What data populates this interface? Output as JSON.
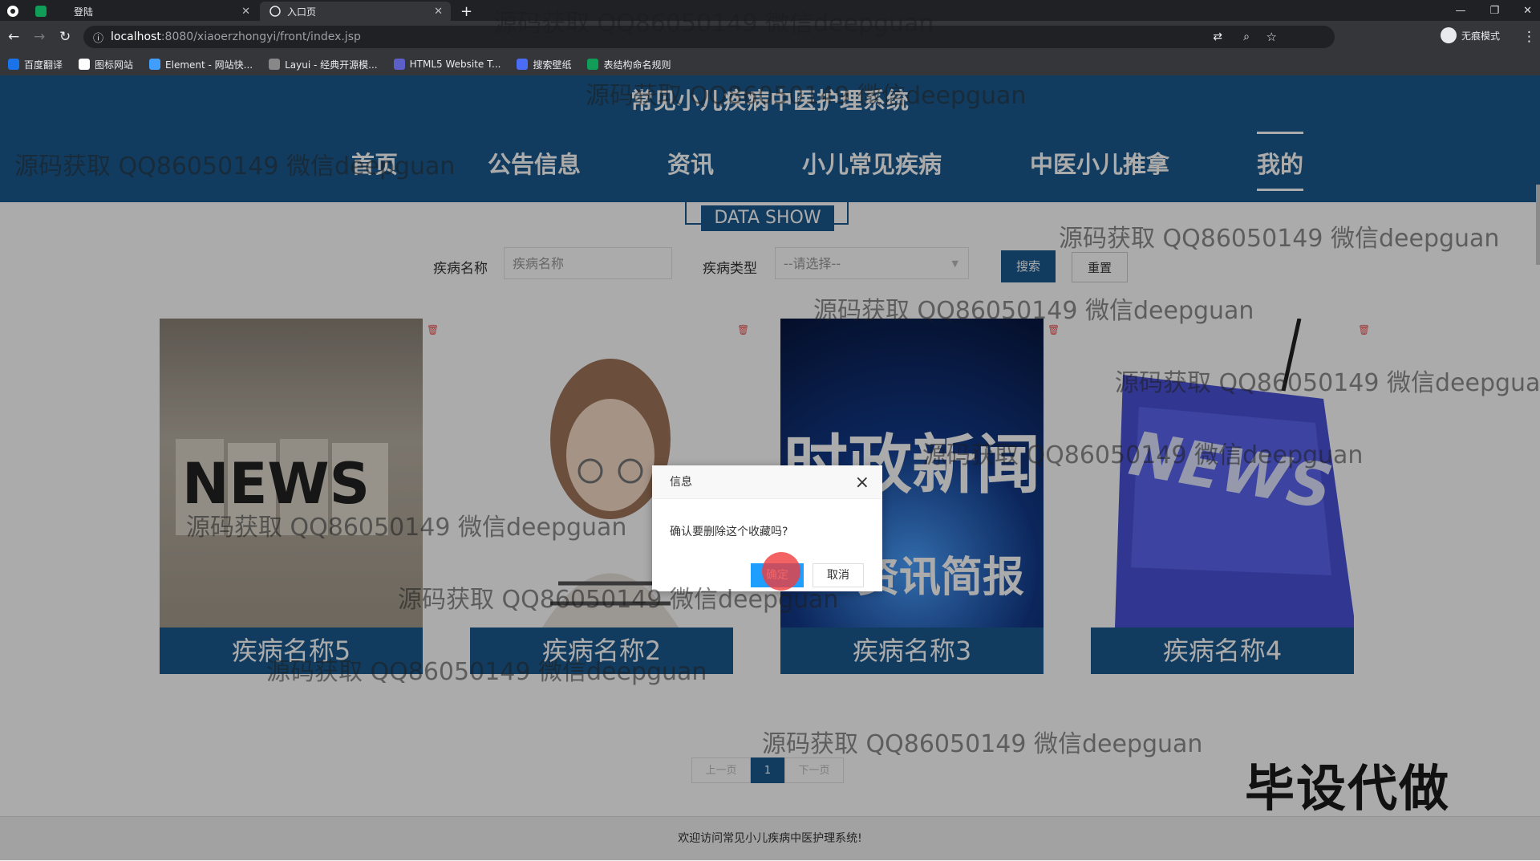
{
  "browser": {
    "tabs": [
      {
        "label": "登陆"
      },
      {
        "label": "入口页"
      }
    ],
    "new_tab": "+",
    "url_host": "localhost",
    "url_path": ":8080/xiaoerzhongyi/front/index.jsp",
    "profile": "无痕模式",
    "bookmarks": [
      {
        "label": "百度翻译",
        "color": "#1a73e8"
      },
      {
        "label": "图标网站",
        "color": "#ffffff"
      },
      {
        "label": "Element - 网站快...",
        "color": "#409eff"
      },
      {
        "label": "Layui - 经典开源模...",
        "color": "#888888"
      },
      {
        "label": "HTML5 Website T...",
        "color": "#5b5fc7"
      },
      {
        "label": "搜索壁纸",
        "color": "#4a6cf7"
      },
      {
        "label": "表结构命名规则",
        "color": "#0f9d58"
      }
    ]
  },
  "site": {
    "title": "常见小儿疾病中医护理系统",
    "nav": [
      {
        "label": "首页"
      },
      {
        "label": "公告信息"
      },
      {
        "label": "资讯"
      },
      {
        "label": "小儿常见疾病"
      },
      {
        "label": "中医小儿推拿"
      },
      {
        "label": "我的"
      }
    ],
    "active_nav": "我的",
    "section_title": "DATA SHOW"
  },
  "search": {
    "name_label": "疾病名称",
    "name_placeholder": "疾病名称",
    "type_label": "疾病类型",
    "type_value": "--请选择--",
    "search_btn": "搜索",
    "reset_btn": "重置"
  },
  "cards": [
    {
      "caption": "疾病名称5",
      "image_text": "NEWS"
    },
    {
      "caption": "疾病名称2",
      "image_text": ""
    },
    {
      "caption": "疾病名称3",
      "image_text": "时政新闻",
      "image_subtext": "资讯简报"
    },
    {
      "caption": "疾病名称4",
      "image_text": "NEWS"
    }
  ],
  "pagination": {
    "prev": "上一页",
    "current": "1",
    "next": "下一页"
  },
  "footer": "欢迎访问常见小儿疾病中医护理系统!",
  "dialog": {
    "title": "信息",
    "message": "确认要删除这个收藏吗?",
    "ok": "确定",
    "cancel": "取消",
    "close": "×"
  },
  "watermark": "源码获取 QQ86050149 微信deepguan",
  "stamp": "毕设代做",
  "colors": {
    "brand": "#1c5a8e",
    "dialog_ok": "#1e9fff"
  }
}
